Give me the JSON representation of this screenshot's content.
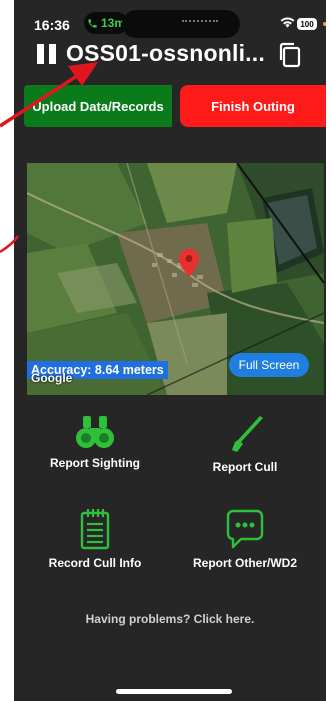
{
  "status_bar": {
    "time": "16:36",
    "call_duration": "13m",
    "battery": "100"
  },
  "header": {
    "title": "OSS01-ossnonli..."
  },
  "actions_top": {
    "upload_label": "Upload Data/Records",
    "finish_label": "Finish Outing"
  },
  "map": {
    "accuracy_text": "Accuracy: 8.64 meters",
    "provider": "Google",
    "fullscreen_label": "Full Screen"
  },
  "grid": {
    "report_sighting": "Report Sighting",
    "report_cull": "Report Cull",
    "record_cull_info": "Record Cull Info",
    "report_other": "Report Other/WD2"
  },
  "help_text": "Having problems? Click here.",
  "colors": {
    "accent_green": "#0a7a1a",
    "icon_green": "#2fbf3a",
    "finish_red": "#ff1a1a",
    "blue": "#1f7fe0",
    "background": "#262626"
  },
  "icons": {
    "pause": "pause-icon",
    "copy": "copy-icon",
    "sighting": "binoculars-icon",
    "cull": "rifle-icon",
    "record": "notepad-icon",
    "other": "chat-bubble-icon",
    "marker": "map-pin-icon"
  }
}
